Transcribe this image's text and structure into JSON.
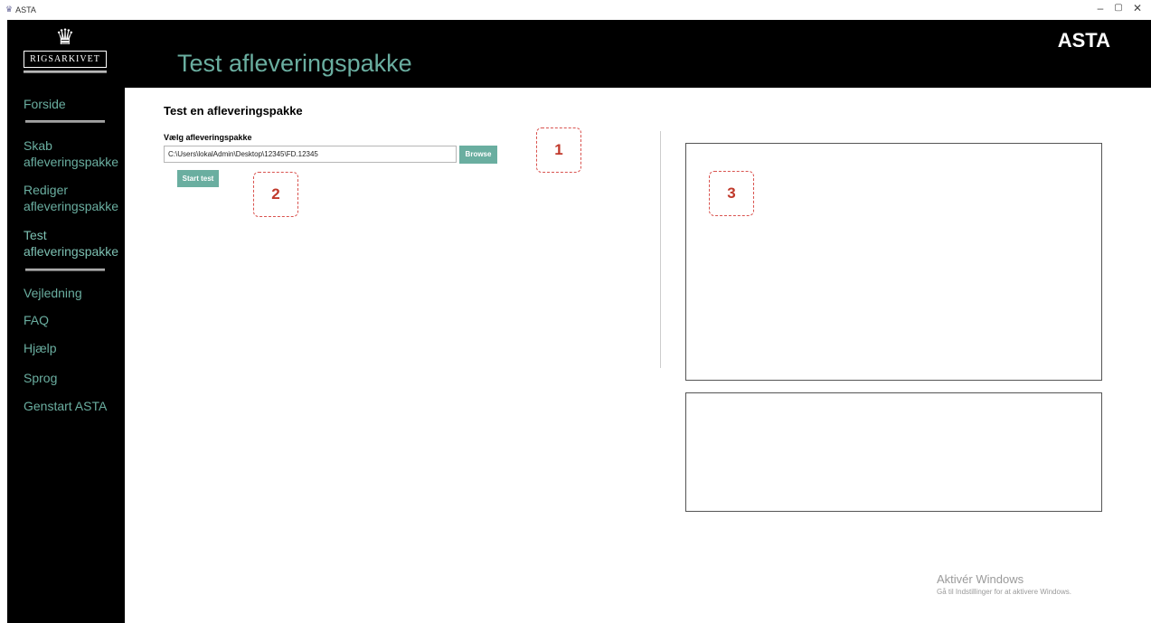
{
  "window": {
    "title": "ASTA",
    "controls": {
      "minimize": "–",
      "restore": "▢",
      "close": "✕"
    }
  },
  "header": {
    "logo_text": "RIGSARKIVET",
    "page_title": "Test afleveringspakke",
    "brand": "ASTA"
  },
  "sidebar": {
    "items": [
      {
        "label": "Forside"
      },
      {
        "label": "Skab afleveringspakke"
      },
      {
        "label": "Rediger afleveringspakke"
      },
      {
        "label": "Test afleveringspakke"
      },
      {
        "label": "Vejledning"
      },
      {
        "label": "FAQ"
      },
      {
        "label": "Hjælp"
      },
      {
        "label": "Sprog"
      },
      {
        "label": "Genstart ASTA"
      }
    ],
    "active_index": 3
  },
  "main": {
    "section_title": "Test en afleveringspakke",
    "field_label": "Vælg afleveringspakke",
    "path_value": "C:\\Users\\lokalAdmin\\Desktop\\12345\\FD.12345",
    "browse_label": "Browse",
    "start_label": "Start test"
  },
  "annotations": [
    "1",
    "2",
    "3"
  ],
  "watermark": {
    "line1": "Aktivér Windows",
    "line2": "Gå til Indstillinger for at aktivere Windows."
  },
  "colors": {
    "accent": "#6aaea0",
    "annotation": "#c0392b"
  }
}
